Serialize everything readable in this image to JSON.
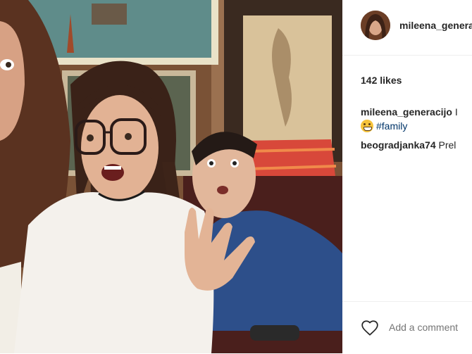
{
  "post": {
    "username": "mileena_generacijo",
    "likes_text": "142 likes",
    "caption": {
      "username": "mileena_generacijo",
      "text_suffix": " I",
      "emoji": "grinning-face-emoji",
      "hashtag": "#family"
    },
    "comments": [
      {
        "username": "beogradjanka74",
        "text": " Prel"
      }
    ]
  },
  "footer": {
    "heart_icon": "heart-outline-icon",
    "comment_placeholder": "Add a comment"
  }
}
